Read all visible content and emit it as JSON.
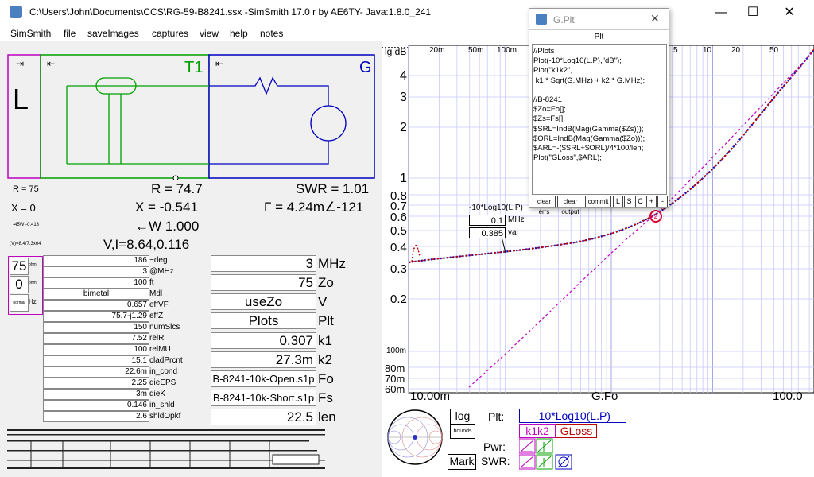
{
  "window": {
    "title": "C:\\Users\\John\\Documents\\CCS\\RG-59-B8241.ssx  -SimSmith 17.0 r by AE6TY-    Java:1.8.0_241",
    "minimize": "—",
    "maximize": "☐",
    "close": "✕"
  },
  "menu": [
    "SimSmith",
    "file",
    "saveImages",
    "captures",
    "view",
    "help",
    "notes"
  ],
  "schematic": {
    "load_label": "L",
    "t1_label": "T1",
    "g_label": "G"
  },
  "readouts": {
    "r_small": "R = 75",
    "x_small": "X = 0",
    "small3": "-45W -0.413",
    "small4": "(V)=8.4/7.3x64",
    "r_big": "R = 74.7",
    "x_big": "X = -0.541",
    "w_big": "←W 1.000",
    "vi_big": "V,I=8.64,0.116",
    "swr_big": "SWR = 1.01",
    "gamma_big": "Γ = 4.24m∠-121"
  },
  "load_fields": {
    "r_value": "75",
    "x_value": "0",
    "r_unit": "ohm",
    "x_unit": "ohm",
    "type_label": "normal",
    "type_unit": "Hz"
  },
  "line_table": [
    {
      "value": "186",
      "label": "~deg"
    },
    {
      "value": "3",
      "label": "@MHz"
    },
    {
      "value": "100",
      "label": "ft"
    },
    {
      "value": "bimetal",
      "label": "Mdl"
    },
    {
      "value": "0.657",
      "label": "effVF"
    },
    {
      "value": "75.7-j1.29",
      "label": "effZ"
    },
    {
      "value": "150",
      "label": "numSlcs"
    },
    {
      "value": "7.52",
      "label": "relR"
    },
    {
      "value": "100",
      "label": "relMU"
    },
    {
      "value": "15.1",
      "label": "cladPrcnt"
    },
    {
      "value": "22.6m",
      "label": "in_cond"
    },
    {
      "value": "2.25",
      "label": "dieEPS"
    },
    {
      "value": "3m",
      "label": "dieK"
    },
    {
      "value": "0.146",
      "label": "in_shld"
    },
    {
      "value": "2.6",
      "label": "shldOpkf"
    }
  ],
  "params": [
    {
      "value": "3",
      "label": "MHz"
    },
    {
      "value": "75",
      "label": "Zo"
    },
    {
      "value": "useZo",
      "label": "V"
    },
    {
      "value": "Plots",
      "label": "Plt"
    },
    {
      "value": "0.307",
      "label": "k1"
    },
    {
      "value": "27.3m",
      "label": "k2"
    },
    {
      "value": "B-8241-10k-Open.s1p",
      "label": "Fo"
    },
    {
      "value": "B-8241-10k-Short.s1p",
      "label": "Fs"
    },
    {
      "value": "22.5",
      "label": "len"
    }
  ],
  "plot": {
    "y_axis_title": "lg dB",
    "x_top_ticks": [
      "20m",
      "50m",
      "100m",
      "5",
      "10",
      "20",
      "50"
    ],
    "y_ticks": [
      "4",
      "3",
      "2",
      "1",
      "0.8",
      "0.7",
      "0.6",
      "0.5",
      "0.4",
      "0.3",
      "0.2",
      "100m",
      "80m",
      "70m",
      "60m"
    ],
    "x_bottom_left": "10.00m",
    "x_bottom_mid": "G.Fo",
    "x_bottom_right": "100.0",
    "tooltip_title": "-10*Log10(L.P)",
    "tooltip_freq": "0.1",
    "tooltip_freq_unit": "MHz",
    "tooltip_val": "0.385",
    "tooltip_val_unit": "val",
    "marker_label": "2",
    "colors": {
      "primary": "#1010c0",
      "secondary": "#c000c0",
      "gloss": "#c00000",
      "grid": "#c8c8ff"
    }
  },
  "bottom_controls": {
    "log_btn": "log",
    "bounds_btn": "bounds",
    "mark_btn": "Mark",
    "plt_label": "Plt:",
    "plt_value": "-10*Log10(L.P)",
    "k1k2_tag": "k1k2",
    "gloss_tag": "GLoss",
    "pwr_label": "Pwr:",
    "swr_label": "SWR:"
  },
  "gplt": {
    "title": "G.Plt",
    "header": "Plt",
    "code": "//Plots\nPlot(-10*Log10(L.P),\"dB\");\nPlot(\"k1k2\",\n k1 * Sqrt(G.MHz) + k2 * G.MHz);\n\n//B-8241\n$Zo=Fo[];\n$Zs=Fs[];\n$SRL=IndB(Mag(Gamma($Zs)));\n$ORL=IndB(Mag(Gamma($Zo)));\n$ARL=-($SRL+$ORL)/4*100/len;\nPlot(\"GLoss\",$ARL);",
    "buttons": [
      "clear errs",
      "clear output",
      "commit",
      "L",
      "S",
      "C",
      "+",
      "-"
    ]
  }
}
